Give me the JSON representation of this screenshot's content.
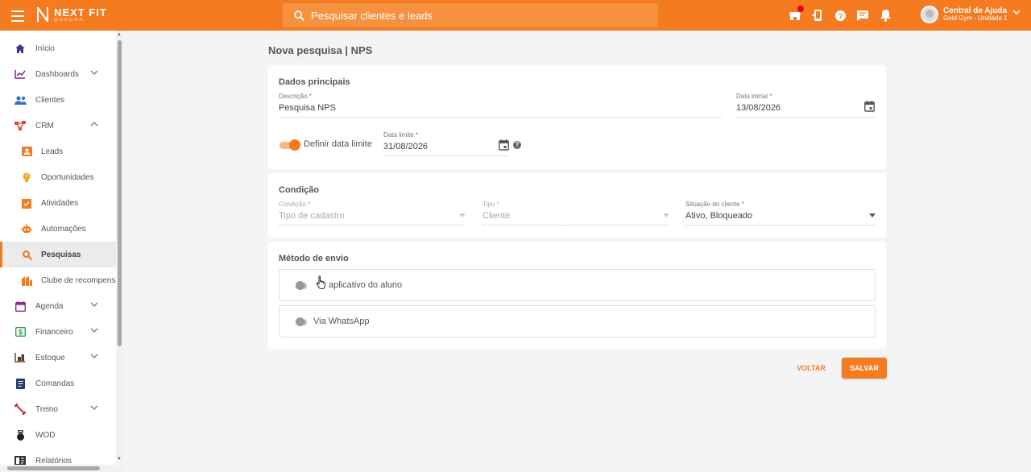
{
  "header": {
    "logo_line1": "NEXT FIT",
    "logo_line2": "QUADRA",
    "search_placeholder": "Pesquisar clientes e leads",
    "icons": [
      "store-icon",
      "mobile-app-icon",
      "help-icon",
      "chat-icon",
      "bell-icon"
    ],
    "user_name": "Central de Ajuda",
    "user_unit": "Gold Gym - Unidade 1"
  },
  "sidebar": {
    "items": [
      {
        "label": "Início",
        "icon": "home-icon"
      },
      {
        "label": "Dashboards",
        "icon": "chart-icon"
      },
      {
        "label": "Clientes",
        "icon": "people-icon"
      },
      {
        "label": "CRM",
        "icon": "crm-icon"
      },
      {
        "label": "Leads",
        "icon": "leads-icon"
      },
      {
        "label": "Oportunidades",
        "icon": "lightbulb-icon"
      },
      {
        "label": "Atividades",
        "icon": "checklist-icon"
      },
      {
        "label": "Automações",
        "icon": "robot-icon"
      },
      {
        "label": "Pesquisas",
        "icon": "search-icon"
      },
      {
        "label": "Clube de recompensas",
        "icon": "reward-icon"
      },
      {
        "label": "Agenda",
        "icon": "calendar-icon"
      },
      {
        "label": "Financeiro",
        "icon": "money-icon"
      },
      {
        "label": "Estoque",
        "icon": "inventory-icon"
      },
      {
        "label": "Comandas",
        "icon": "receipt-icon"
      },
      {
        "label": "Treino",
        "icon": "fitness-icon"
      },
      {
        "label": "WOD",
        "icon": "kettlebell-icon"
      },
      {
        "label": "Relatórios",
        "icon": "report-icon"
      }
    ]
  },
  "main": {
    "page_title": "Nova pesquisa | NPS",
    "dados": {
      "title": "Dados principais",
      "descricao_label": "Descrição *",
      "descricao_value": "Pesquisa NPS",
      "data_inicial_label": "Data inicial *",
      "data_inicial_value": "13/08/2026",
      "toggle_label": "Definir data limite",
      "data_limite_label": "Data limite *",
      "data_limite_value": "31/08/2026"
    },
    "condicao": {
      "title": "Condição",
      "condicao_label": "Condição *",
      "condicao_value": "Tipo de cadastro",
      "tipo_label": "Tipo *",
      "tipo_value": "Cliente",
      "situacao_label": "Situação do cliente *",
      "situacao_value": "Ativo, Bloqueado"
    },
    "metodo": {
      "title": "Método de envio",
      "app_label": "aplicativo do aluno",
      "whatsapp_label": "Via WhatsApp"
    },
    "back_label": "VOLTAR",
    "save_label": "SALVAR"
  },
  "colors": {
    "accent": "#f47b20"
  }
}
